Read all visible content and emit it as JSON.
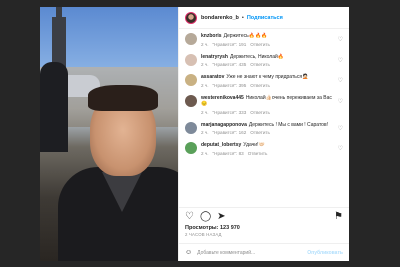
{
  "header": {
    "username": "bondarenko_b",
    "separator": "•",
    "follow_label": "Подписаться"
  },
  "comments": [
    {
      "user": "knzboris",
      "text": "Держитесь🔥🔥🔥",
      "time": "2 ч.",
      "likes": "\"Нравится\": 191",
      "reply": "Ответить",
      "avatar_color": "#b6a999"
    },
    {
      "user": "lenatryrysh",
      "text": "Держитесь, Николай🔥",
      "time": "2 ч.",
      "likes": "\"Нравится\": 435",
      "reply": "Ответить",
      "avatar_color": "#d7c0b3"
    },
    {
      "user": "assaratov",
      "text": "Уже не знают к чему придраться🤦🏻",
      "time": "2 ч.",
      "likes": "\"Нравится\": 395",
      "reply": "Ответить",
      "avatar_color": "#c9b183"
    },
    {
      "user": "westerenikova445",
      "text": "Николай👍🏻очень переживаем за Вас😔",
      "time": "2 ч.",
      "likes": "\"Нравится\": 333",
      "reply": "Ответить",
      "avatar_color": "#6d5a4f"
    },
    {
      "user": "marjanagapponova",
      "text": "Держитесь ! Мы с вами ! Саратов!",
      "time": "2 ч.",
      "likes": "\"Нравится\": 162",
      "reply": "Ответить",
      "avatar_color": "#7e8a9a"
    },
    {
      "user": "deputat_lobertsy",
      "text": "Удачи!🤝🏻",
      "time": "2 ч.",
      "likes": "\"Нравится\": 83",
      "reply": "Ответить",
      "avatar_color": "#5aa05a"
    }
  ],
  "actions": {
    "like_icon": "♡",
    "comment_icon": "◯",
    "share_icon": "➤",
    "bookmark_icon": "⚑"
  },
  "views": "Просмотры: 123 970",
  "posted_time": "2 ЧАСОВ НАЗАД",
  "add_comment": {
    "placeholder": "Добавьте комментарий...",
    "publish_label": "Опубликовать",
    "emoji_icon": "☺"
  },
  "colors": {
    "accent": "#0095f6",
    "muted": "#8e8e8e",
    "backdrop": "#262626"
  }
}
